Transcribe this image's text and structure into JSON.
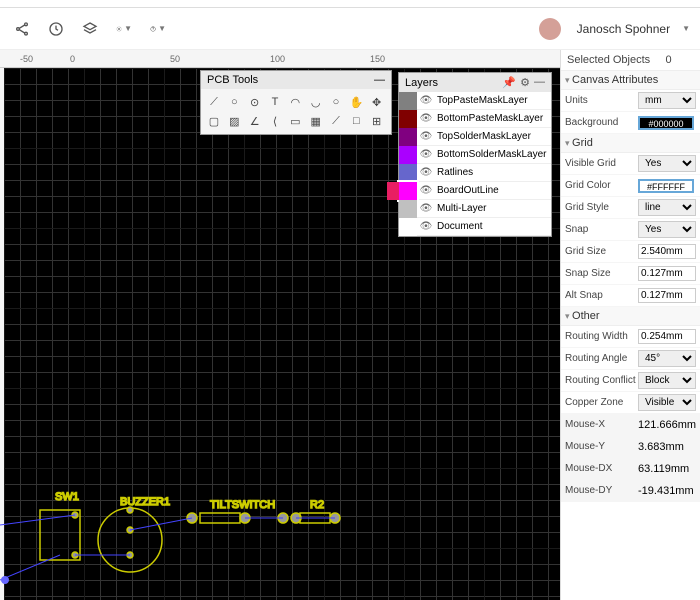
{
  "header": {
    "username": "Janosch Spohner"
  },
  "selected": {
    "label": "Selected Objects",
    "count": "0"
  },
  "sections": {
    "canvas": "Canvas Attributes",
    "grid": "Grid",
    "other": "Other"
  },
  "canvas_attrs": {
    "units_label": "Units",
    "units": "mm",
    "bg_label": "Background",
    "bg": "#000000"
  },
  "grid_attrs": {
    "visible_label": "Visible Grid",
    "visible": "Yes",
    "color_label": "Grid Color",
    "color": "#FFFFFF",
    "style_label": "Grid Style",
    "style": "line",
    "snap_label": "Snap",
    "snap": "Yes",
    "size_label": "Grid Size",
    "size": "2.540mm",
    "snapsize_label": "Snap Size",
    "snapsize": "0.127mm",
    "altsnap_label": "Alt Snap",
    "altsnap": "0.127mm"
  },
  "other_attrs": {
    "rw_label": "Routing Width",
    "rw": "0.254mm",
    "ra_label": "Routing Angle",
    "ra": "45°",
    "rc_label": "Routing Conflict",
    "rc": "Block",
    "cz_label": "Copper Zone",
    "cz": "Visible"
  },
  "mouse": {
    "x_label": "Mouse-X",
    "x": "121.666mm",
    "y_label": "Mouse-Y",
    "y": "3.683mm",
    "dx_label": "Mouse-DX",
    "dx": "63.119mm",
    "dy_label": "Mouse-DY",
    "dy": "-19.431mm"
  },
  "pcb_tools": {
    "title": "PCB Tools"
  },
  "layers": {
    "title": "Layers",
    "items": [
      {
        "name": "TopPasteMaskLayer",
        "color": "#808080"
      },
      {
        "name": "BottomPasteMaskLayer",
        "color": "#800000"
      },
      {
        "name": "TopSolderMaskLayer",
        "color": "#800080"
      },
      {
        "name": "BottomSolderMaskLayer",
        "color": "#aa00ff"
      },
      {
        "name": "Ratlines",
        "color": "#6666cc"
      },
      {
        "name": "BoardOutLine",
        "color": "#ff00ff"
      },
      {
        "name": "Multi-Layer",
        "color": "#c0c0c0"
      },
      {
        "name": "Document",
        "color": "#ffffff"
      }
    ]
  },
  "ruler": [
    "-50",
    "0",
    "50",
    "100",
    "150"
  ],
  "circuit_labels": {
    "sw1": "SW1",
    "buzzer": "BUZZER1",
    "tilt": "TILTSWITCH",
    "r2": "R2"
  }
}
